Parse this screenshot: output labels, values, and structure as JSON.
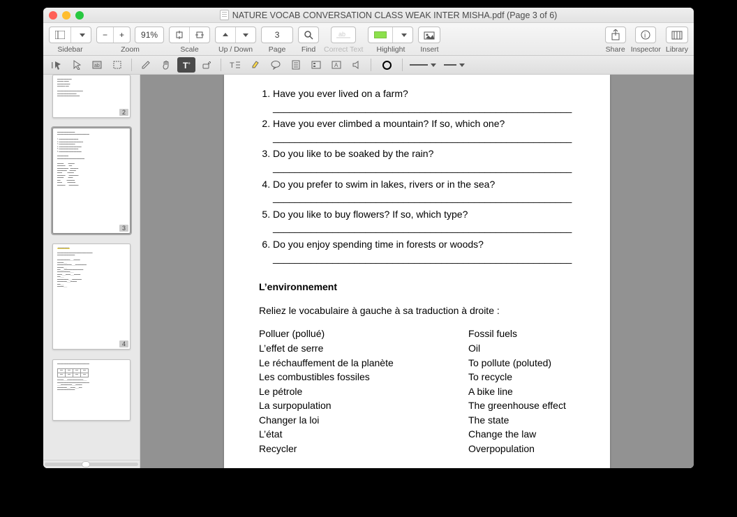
{
  "title": "NATURE VOCAB CONVERSATION CLASS WEAK INTER MISHA.pdf (Page 3 of 6)",
  "toolbar": {
    "sidebar": "Sidebar",
    "zoom": "Zoom",
    "zoom_val": "91%",
    "scale": "Scale",
    "updown": "Up / Down",
    "page": "Page",
    "page_val": "3",
    "find": "Find",
    "correct": "Correct Text",
    "highlight": "Highlight",
    "insert": "Insert",
    "share": "Share",
    "inspector": "Inspector",
    "library": "Library"
  },
  "thumbs": {
    "p2": "2",
    "p3": "3",
    "p4": "4"
  },
  "doc": {
    "q1": "Have you ever lived on a farm?",
    "q2": "Have you ever climbed a mountain? If so, which one?",
    "q3": "Do you like to be soaked by the rain?",
    "q4": "Do you prefer to swim in lakes, rivers or in the sea?",
    "q5": "Do you like to buy flowers? If so, which type?",
    "q6": "Do you enjoy spending time in forests or woods?",
    "line": "_______________________________________________________",
    "section": "L’environnement",
    "instr": "Reliez le vocabulaire à gauche à sa traduction à droite :",
    "left": [
      "Polluer (pollué)",
      "L’effet de serre",
      "Le réchauffement de la planète",
      "Les combustibles fossiles",
      "Le pétrole",
      "La surpopulation",
      "Changer la loi",
      "L’état",
      "Recycler"
    ],
    "right": [
      "Fossil fuels",
      "Oil",
      "To pollute (poluted)",
      "To recycle",
      "A bike line",
      "The greenhouse effect",
      "The state",
      "Change the law",
      "Overpopulation"
    ]
  }
}
